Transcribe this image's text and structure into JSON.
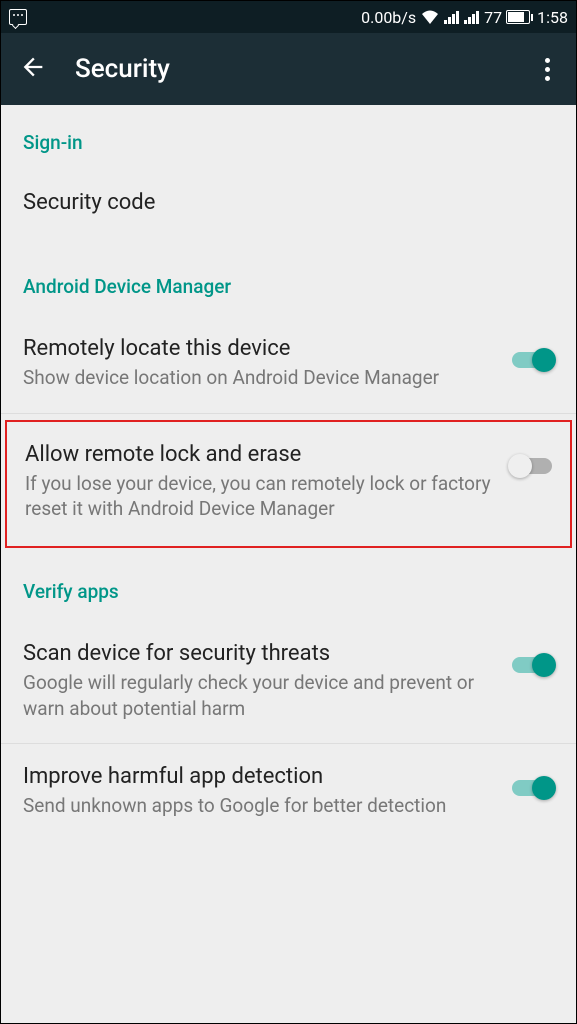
{
  "statusBar": {
    "dataRate": "0.00b/s",
    "battery": "77",
    "time": "1:58"
  },
  "appBar": {
    "title": "Security"
  },
  "sections": [
    {
      "header": "Sign-in",
      "items": [
        {
          "title": "Security code",
          "subtitle": "",
          "hasToggle": false
        }
      ]
    },
    {
      "header": "Android Device Manager",
      "items": [
        {
          "title": "Remotely locate this device",
          "subtitle": "Show device location on Android Device Manager",
          "hasToggle": true,
          "toggleOn": true
        },
        {
          "title": "Allow remote lock and erase",
          "subtitle": "If you lose your device, you can remotely lock or factory reset it with Android Device Manager",
          "hasToggle": true,
          "toggleOn": false,
          "highlighted": true
        }
      ]
    },
    {
      "header": "Verify apps",
      "items": [
        {
          "title": "Scan device for security threats",
          "subtitle": "Google will regularly check your device and prevent or warn about potential harm",
          "hasToggle": true,
          "toggleOn": true
        },
        {
          "title": "Improve harmful app detection",
          "subtitle": "Send unknown apps to Google for better detection",
          "hasToggle": true,
          "toggleOn": true
        }
      ]
    }
  ]
}
